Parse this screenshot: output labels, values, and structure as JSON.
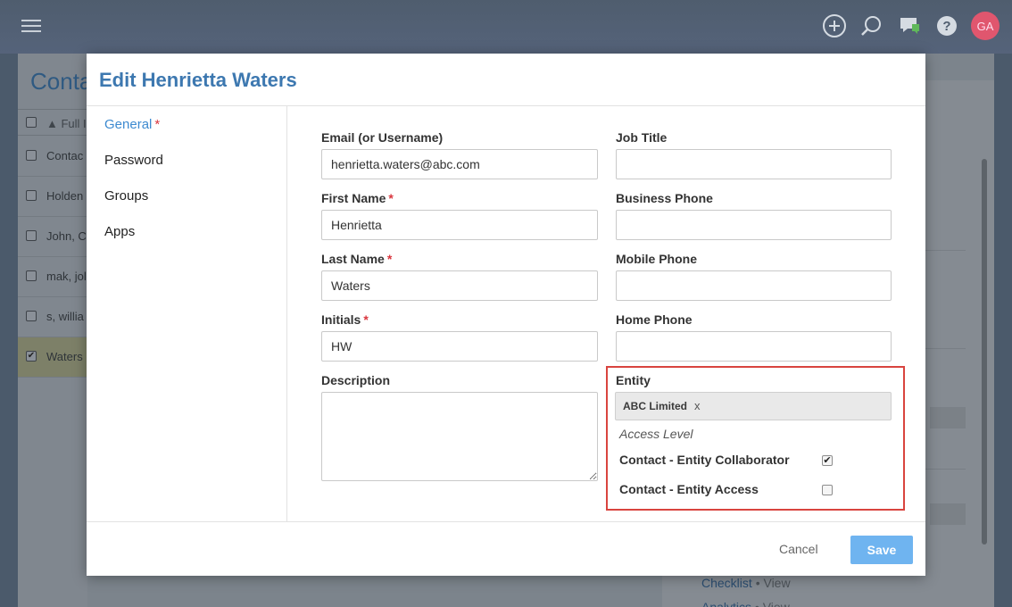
{
  "topbar": {
    "avatar_initials": "GA"
  },
  "background": {
    "title": "Conta",
    "column_header": "▲ Full I",
    "rows": [
      {
        "text": "Contac",
        "checked": false
      },
      {
        "text": "Holden",
        "checked": false
      },
      {
        "text": "John, C",
        "checked": false
      },
      {
        "text": "mak, jol",
        "checked": false
      },
      {
        "text": "s, willia",
        "checked": false
      },
      {
        "text": "Waters",
        "checked": true
      }
    ],
    "link1": "Checklist",
    "link1_suffix": "• View",
    "link2": "Analytics",
    "link2_suffix": "• View"
  },
  "modal": {
    "title": "Edit Henrietta Waters",
    "nav": {
      "general": "General",
      "password": "Password",
      "groups": "Groups",
      "apps": "Apps"
    },
    "required_mark": "*",
    "fields": {
      "email_label": "Email (or Username)",
      "email_value": "henrietta.waters@abc.com",
      "first_name_label": "First Name",
      "first_name_value": "Henrietta",
      "last_name_label": "Last Name",
      "last_name_value": "Waters",
      "initials_label": "Initials",
      "initials_value": "HW",
      "description_label": "Description",
      "description_value": "",
      "job_title_label": "Job Title",
      "job_title_value": "",
      "business_phone_label": "Business Phone",
      "business_phone_value": "",
      "mobile_phone_label": "Mobile Phone",
      "mobile_phone_value": "",
      "home_phone_label": "Home Phone",
      "home_phone_value": ""
    },
    "entity": {
      "label": "Entity",
      "chip": "ABC Limited",
      "chip_remove": "x",
      "access_level": "Access Level",
      "permissions": [
        {
          "label": "Contact - Entity Collaborator",
          "checked": true
        },
        {
          "label": "Contact - Entity Access",
          "checked": false
        }
      ]
    },
    "footer": {
      "cancel": "Cancel",
      "save": "Save"
    }
  },
  "colors": {
    "accent": "#3d78b0",
    "save_button": "#6fb4f0",
    "highlight_border": "#d9443f",
    "required": "#d9363e"
  }
}
